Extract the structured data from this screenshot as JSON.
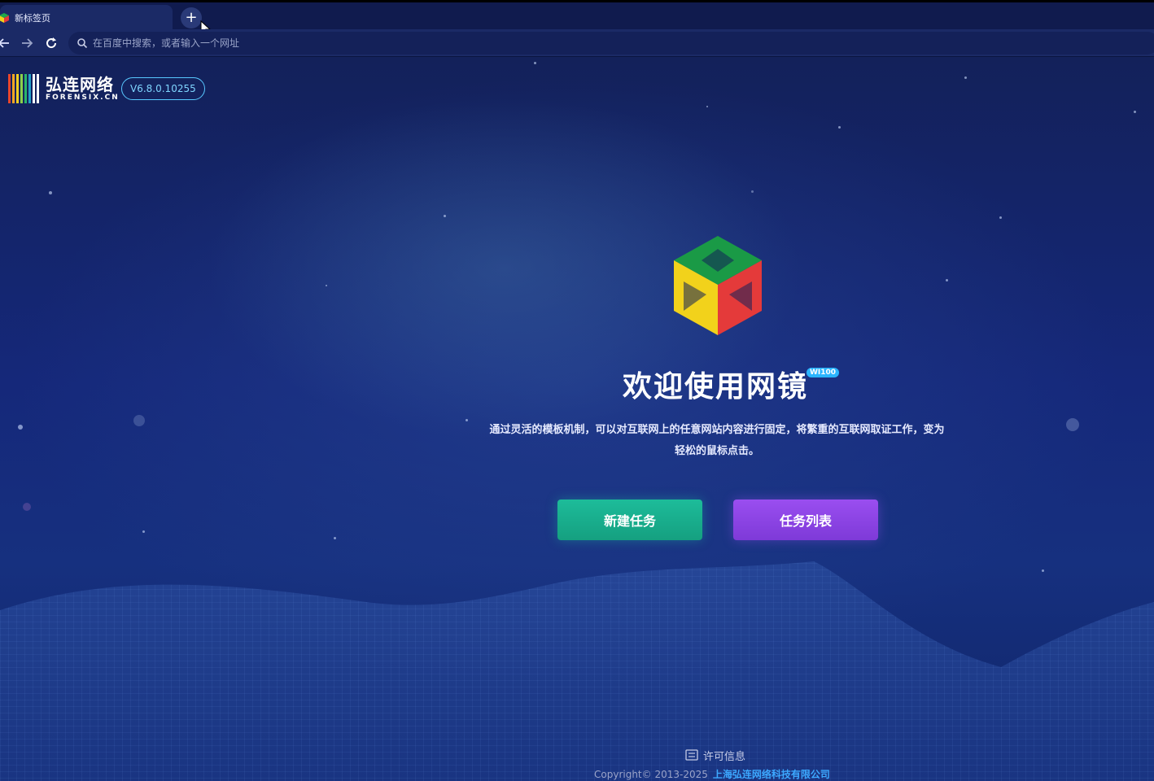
{
  "browser": {
    "tab_title": "新标签页",
    "new_tab_symbol": "+",
    "address_placeholder": "在百度中搜索，或者输入一个网址"
  },
  "brand": {
    "name": "弘连网络",
    "domain": "FORENSIX.CN",
    "version": "V6.8.0.10255"
  },
  "hero": {
    "title": "欢迎使用网镜",
    "title_tag": "WI100",
    "description": "通过灵活的模板机制，可以对互联网上的任意网站内容进行固定，将繁重的互联网取证工作，变为轻松的鼠标点击。"
  },
  "actions": {
    "new_task": "新建任务",
    "task_list": "任务列表"
  },
  "footer": {
    "license_label": "许可信息",
    "copyright": "Copyright© 2013-2025",
    "company": "上海弘连网络科技有限公司"
  },
  "colors": {
    "background": "#13215a",
    "new_task_button": "#1dbc9a",
    "task_list_button": "#9a4ef0",
    "version_badge": "#58c8ff",
    "company_link": "#3ca8ff"
  }
}
